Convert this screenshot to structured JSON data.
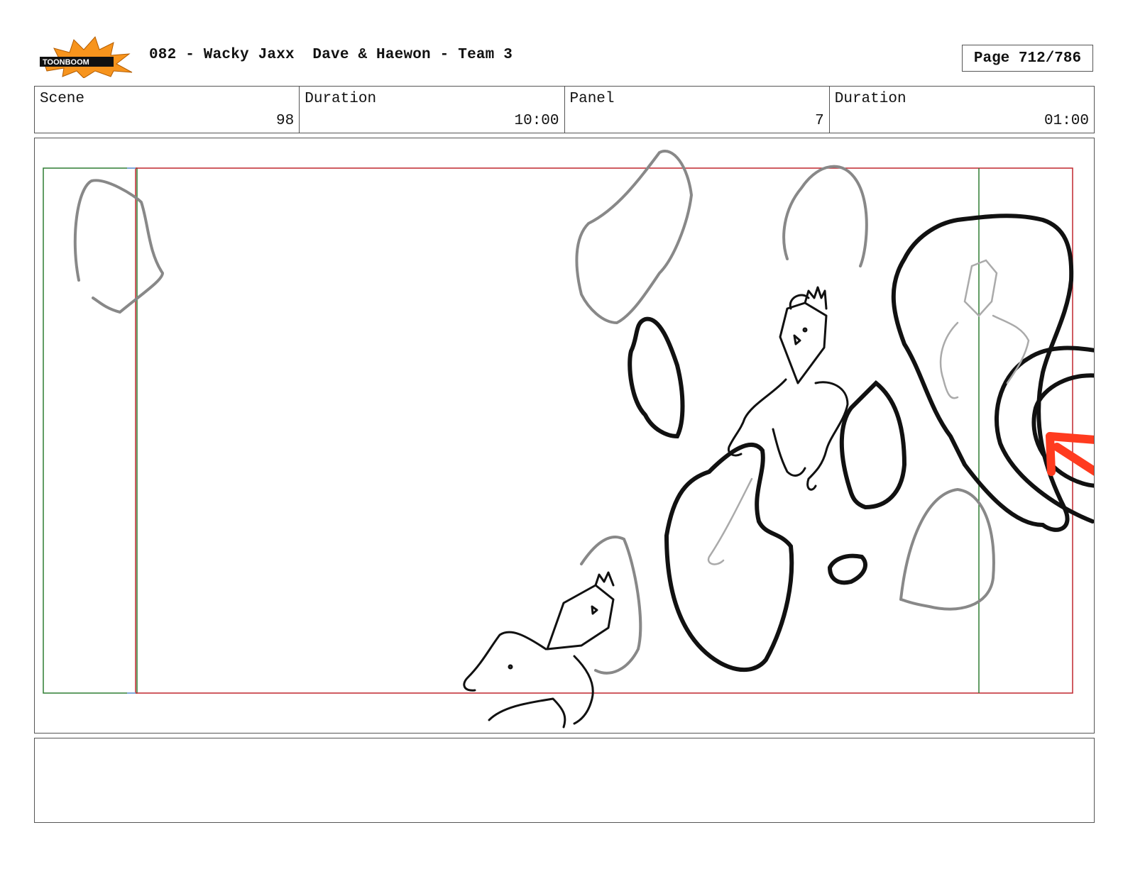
{
  "header": {
    "logo_text": "TOONBOOM",
    "title": "082 - Wacky Jaxx  Dave & Haewon - Team 3",
    "page_label": "Page 712/786"
  },
  "info": {
    "scene_label": "Scene",
    "scene_value": "98",
    "scene_duration_label": "Duration",
    "scene_duration_value": "10:00",
    "panel_label": "Panel",
    "panel_value": "7",
    "panel_duration_label": "Duration",
    "panel_duration_value": "01:00"
  },
  "notes": {
    "text": ""
  },
  "colors": {
    "frame_red": "#c0262d",
    "frame_green": "#2e7d32",
    "arrow_red": "#ff3b1f",
    "logo_orange": "#f7941d"
  }
}
